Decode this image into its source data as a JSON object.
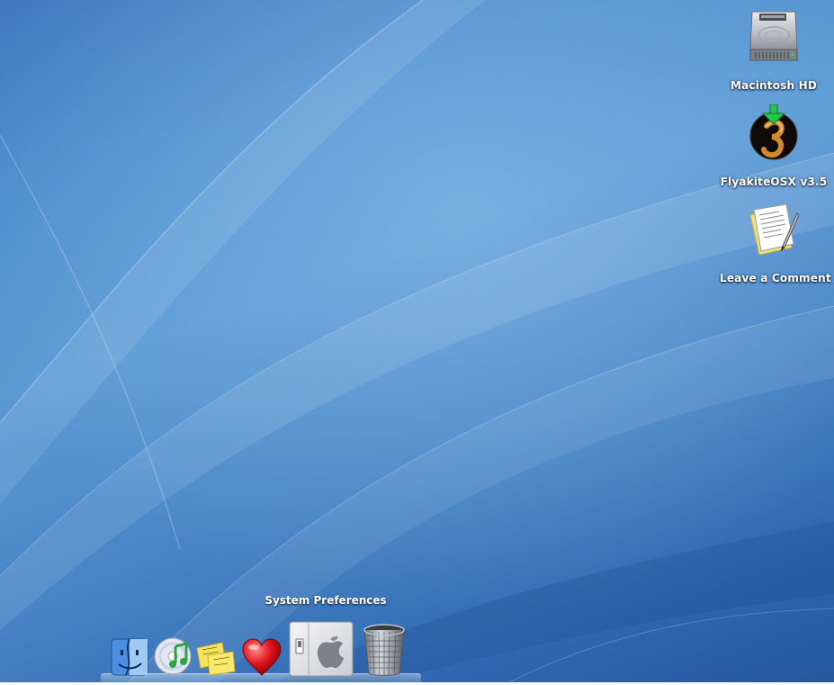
{
  "desktop": {
    "icons": [
      {
        "name": "macintosh-hd",
        "label": "Macintosh HD",
        "icon": "hard-drive-icon"
      },
      {
        "name": "flyakiteosx",
        "label": "FlyakiteOSX v3.5",
        "icon": "flyakite-installer-icon"
      },
      {
        "name": "leave-a-comment",
        "label": "Leave a Comment",
        "icon": "text-document-icon"
      }
    ]
  },
  "dock": {
    "tooltip": "System Preferences",
    "items": [
      {
        "name": "finder",
        "icon": "finder-icon"
      },
      {
        "name": "itunes",
        "icon": "itunes-icon"
      },
      {
        "name": "stickies",
        "icon": "stickies-icon"
      },
      {
        "name": "favorites",
        "icon": "heart-icon"
      },
      {
        "name": "system-preferences",
        "icon": "system-preferences-icon"
      },
      {
        "name": "trash",
        "icon": "trash-icon"
      }
    ]
  },
  "colors": {
    "wallpaper_blue": "#4f8fd0",
    "label_text": "#ffffff"
  }
}
